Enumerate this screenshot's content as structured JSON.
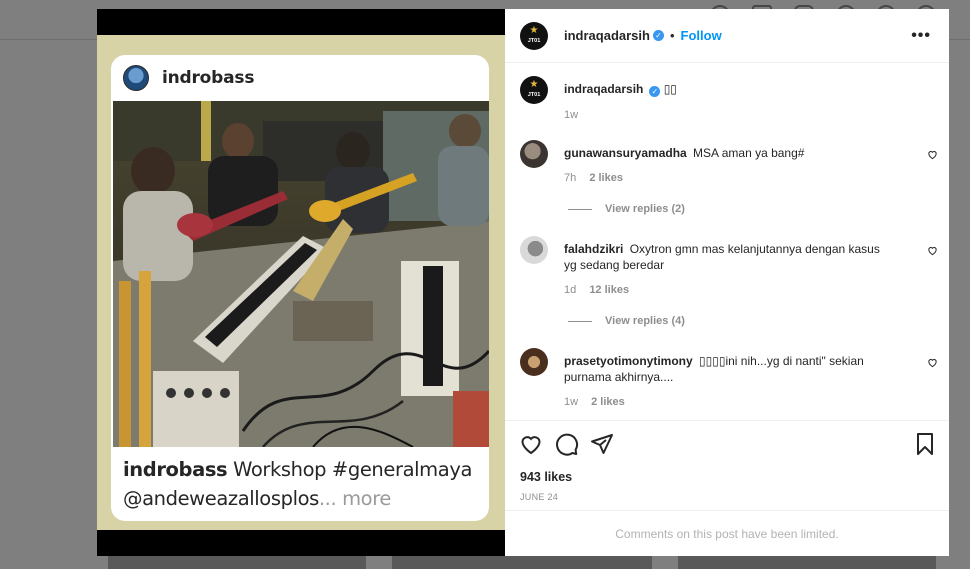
{
  "post": {
    "media": {
      "embedded_card": {
        "username": "indrobass",
        "caption_user": "indrobass",
        "caption_text": "Workshop",
        "caption_hashtag": "#generalmaya",
        "caption_mention": "@andeweazallosplos",
        "caption_more": "... more"
      }
    },
    "header": {
      "username": "indraqadarsih",
      "avatar_label": "JT01",
      "follow_label": "Follow",
      "dot": "•",
      "more_icon": "more-horizontal-icon"
    },
    "caption": {
      "username": "indraqadarsih",
      "text": "▯▯",
      "time": "1w"
    },
    "comments": [
      {
        "username": "gunawansuryamadha",
        "text": "MSA aman ya bang#",
        "time": "7h",
        "likes": "2 likes",
        "view_replies": "View replies (2)"
      },
      {
        "username": "falahdzikri",
        "text": "Oxytron gmn mas kelanjutannya dengan kasus yg sedang beredar",
        "time": "1d",
        "likes": "12 likes",
        "view_replies": "View replies (4)"
      },
      {
        "username": "prasetyotimonytimony",
        "text": "▯▯▯▯ini nih...yg di nanti\" sekian purnama akhirnya....",
        "time": "1w",
        "likes": "2 likes"
      }
    ],
    "actions": {
      "icons": [
        "heart-icon",
        "comment-icon",
        "share-icon",
        "bookmark-icon"
      ],
      "likes": "943 likes",
      "date": "JUNE 24"
    },
    "comments_limited": "Comments on this post have been limited."
  },
  "colors": {
    "follow": "#0095f6",
    "verified": "#3897f0",
    "muted": "#8e8e8e",
    "backdrop": "#7f7f7f"
  }
}
